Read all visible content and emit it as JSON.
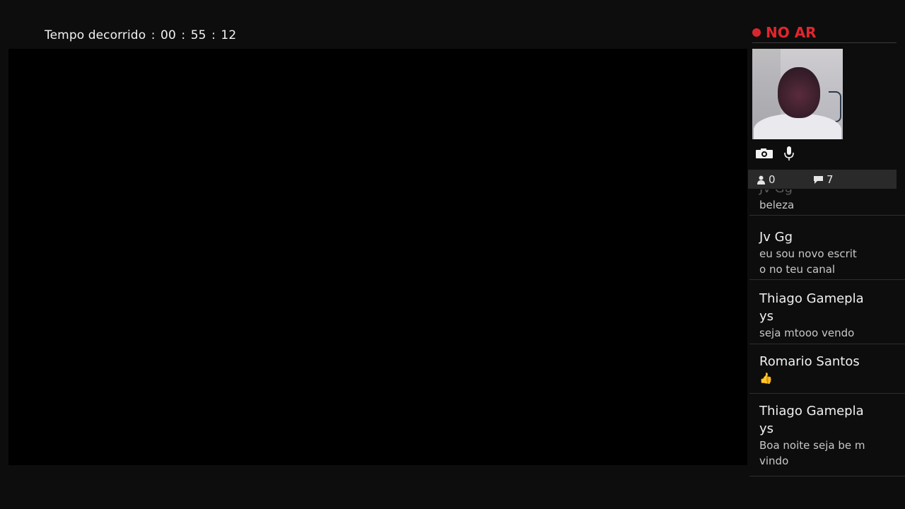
{
  "header": {
    "elapsed_label": "Tempo decorrido",
    "elapsed_hours": "00",
    "elapsed_minutes": "55",
    "elapsed_seconds": "12"
  },
  "live": {
    "status_label": "NO AR",
    "status_color": "#e0262d"
  },
  "camera": {
    "camera_icon": "camera-icon",
    "mic_icon": "microphone-icon"
  },
  "stats": {
    "viewers_icon": "person-icon",
    "viewers_count": "0",
    "comments_icon": "speech-bubble-icon",
    "comments_count": "7"
  },
  "chat": {
    "messages": [
      {
        "user": "Jv Gg",
        "text": "beleza"
      },
      {
        "user": "Jv Gg",
        "text": "eu sou novo escrit o no teu canal"
      },
      {
        "user": "Thiago Gamepla ys",
        "text": "seja mtooo vendo"
      },
      {
        "user": "Romario Santos",
        "text": "👍"
      },
      {
        "user": "Thiago Gamepla ys",
        "text": "Boa noite seja be m vindo"
      }
    ]
  }
}
